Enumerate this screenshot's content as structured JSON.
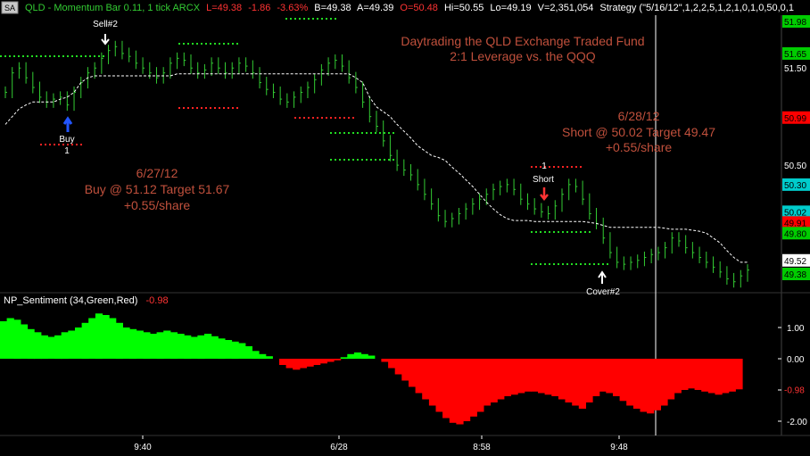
{
  "header": {
    "symbol_box": "SA",
    "title": "QLD - Momentum Bar 0.11, 1 tick  ARCX",
    "last": "L=49.38",
    "change": "-1.86",
    "change_pct": "-3.63%",
    "bid": "B=49.38",
    "ask": "A=49.39",
    "open": "O=50.48",
    "hi": "Hi=50.55",
    "lo": "Lo=49.19",
    "volume": "V=2,351,054",
    "strategy": "Strategy (\"5/16/12\",1,2,2,5,1,2,1,0,1,0,50,0,1"
  },
  "colors": {
    "up_bar": "#33cc33",
    "positive_area": "#00ff00",
    "negative_area": "#ff0000",
    "annotation": "#c0503c",
    "trailing_line": "#ffffff"
  },
  "annotations": {
    "main_title_1": "Daytrading the QLD Exchange Traded Fund",
    "main_title_2": "2:1 Leverage vs. the QQQ",
    "trade1_date": "6/27/12",
    "trade1_detail": "Buy @ 51.12 Target 51.67",
    "trade1_profit": "+0.55/share",
    "trade2_date": "6/28/12",
    "trade2_detail": "Short @ 50.02 Target 49.47",
    "trade2_profit": "+0.55/share"
  },
  "signals": {
    "sell2": "Sell#2",
    "buy": "Buy",
    "buy_num": "1",
    "short": "Short",
    "short_num": "1",
    "cover2": "Cover#2"
  },
  "indicator": {
    "name": "NP_Sentiment (34,Green,Red)",
    "value": "-0.98"
  },
  "chart_data": [
    {
      "type": "line",
      "panel": "price",
      "ylim": [
        49.2,
        52.1
      ],
      "price_axis_labels": [
        {
          "value": "51.98",
          "bg": "#00cc00",
          "fg": "#000000"
        },
        {
          "value": "51.65",
          "bg": "#00cc00",
          "fg": "#000000"
        },
        {
          "value": "51.50",
          "bg": "",
          "fg": "#ffffff"
        },
        {
          "value": "50.99",
          "bg": "#ff0000",
          "fg": "#000000"
        },
        {
          "value": "50.50",
          "bg": "",
          "fg": "#ffffff"
        },
        {
          "value": "50.30",
          "bg": "#00cccc",
          "fg": "#000000"
        },
        {
          "value": "50.02",
          "bg": "#00cccc",
          "fg": "#000000"
        },
        {
          "value": "49.91",
          "bg": "#ff0000",
          "fg": "#000000"
        },
        {
          "value": "49.80",
          "bg": "#00cc00",
          "fg": "#000000"
        },
        {
          "value": "49.52",
          "bg": "#ffffff",
          "fg": "#000000"
        },
        {
          "value": "49.38",
          "bg": "#00cc00",
          "fg": "#000000"
        }
      ],
      "series": [
        {
          "values": [
            51.25,
            51.45,
            51.5,
            51.4,
            51.3,
            51.2,
            51.15,
            51.18,
            51.2,
            51.12,
            51.25,
            51.35,
            51.45,
            51.5,
            51.6,
            51.68,
            51.72,
            51.65,
            51.62,
            51.55,
            51.5,
            51.45,
            51.4,
            51.45,
            51.55,
            51.6,
            51.58,
            51.5,
            51.45,
            51.48,
            51.55,
            51.5,
            51.45,
            51.5,
            51.55,
            51.52,
            51.45,
            51.35,
            51.28,
            51.25,
            51.18,
            51.15,
            51.2,
            51.25,
            51.3,
            51.38,
            51.48,
            51.55,
            51.58,
            51.52,
            51.4,
            51.3,
            51.15,
            51.0,
            50.9,
            50.75,
            50.6,
            50.5,
            50.45,
            50.4,
            50.3,
            50.2,
            50.1,
            49.98,
            49.92,
            49.95,
            50.0,
            50.05,
            50.1,
            50.15,
            50.2,
            50.25,
            50.28,
            50.3,
            50.25,
            50.15,
            50.1,
            50.05,
            50.02,
            50.0,
            50.08,
            50.2,
            50.3,
            50.28,
            50.15,
            50.0,
            49.9,
            49.75,
            49.6,
            49.5,
            49.48,
            49.5,
            49.52,
            49.55,
            49.58,
            49.6,
            49.65,
            49.75,
            49.72,
            49.65,
            49.6,
            49.55,
            49.5,
            49.45,
            49.4,
            49.33,
            49.3,
            49.36,
            49.42
          ]
        },
        {
          "values": [
            50.92,
            51.0,
            51.08,
            51.12,
            51.15,
            51.15,
            51.15,
            51.15,
            51.18,
            51.2,
            51.25,
            51.35,
            51.4,
            51.42,
            51.42,
            51.42,
            51.42,
            51.42,
            51.42,
            51.42,
            51.42,
            51.42,
            51.42,
            51.42,
            51.42,
            51.44,
            51.44,
            51.44,
            51.44,
            51.44,
            51.44,
            51.44,
            51.44,
            51.44,
            51.44,
            51.44,
            51.44,
            51.44,
            51.44,
            51.44,
            51.44,
            51.44,
            51.44,
            51.44,
            51.44,
            51.44,
            51.44,
            51.44,
            51.44,
            51.44,
            51.44,
            51.4,
            51.35,
            51.2,
            51.1,
            51.05,
            51.0,
            50.92,
            50.85,
            50.78,
            50.7,
            50.65,
            50.6,
            50.58,
            50.55,
            50.48,
            50.42,
            50.35,
            50.28,
            50.2,
            50.12,
            50.05,
            49.99,
            49.95,
            49.93,
            49.93,
            49.93,
            49.92,
            49.92,
            49.92,
            49.92,
            49.92,
            49.92,
            49.92,
            49.92,
            49.91,
            49.9,
            49.88,
            49.86,
            49.86,
            49.86,
            49.86,
            49.86,
            49.86,
            49.86,
            49.86,
            49.85,
            49.84,
            49.84,
            49.84,
            49.83,
            49.82,
            49.8,
            49.75,
            49.7,
            49.62,
            49.55,
            49.5,
            49.5
          ]
        }
      ]
    },
    {
      "type": "area",
      "panel": "indicator",
      "ylim": [
        -2.3,
        1.4
      ],
      "tick_labels": [
        "1.00",
        "0.00",
        "-1.00",
        "-2.00"
      ],
      "current_value_label": "-0.98",
      "values": [
        1.2,
        1.3,
        1.25,
        1.1,
        0.95,
        0.85,
        0.75,
        0.7,
        0.75,
        0.85,
        0.9,
        1.0,
        1.15,
        1.3,
        1.45,
        1.4,
        1.3,
        1.15,
        1.0,
        0.95,
        0.9,
        0.85,
        0.8,
        0.85,
        0.9,
        0.85,
        0.8,
        0.75,
        0.7,
        0.75,
        0.8,
        0.72,
        0.65,
        0.6,
        0.55,
        0.5,
        0.4,
        0.25,
        0.15,
        0.08,
        0.0,
        -0.2,
        -0.3,
        -0.35,
        -0.3,
        -0.25,
        -0.2,
        -0.15,
        -0.1,
        -0.05,
        0.05,
        0.15,
        0.2,
        0.15,
        0.1,
        0.0,
        -0.1,
        -0.3,
        -0.5,
        -0.7,
        -0.9,
        -1.1,
        -1.3,
        -1.5,
        -1.7,
        -1.9,
        -2.05,
        -2.1,
        -2.0,
        -1.85,
        -1.7,
        -1.5,
        -1.4,
        -1.3,
        -1.2,
        -1.15,
        -1.1,
        -1.05,
        -1.05,
        -1.1,
        -1.15,
        -1.2,
        -1.3,
        -1.4,
        -1.5,
        -1.6,
        -1.4,
        -1.2,
        -1.05,
        -1.1,
        -1.2,
        -1.35,
        -1.5,
        -1.6,
        -1.7,
        -1.75,
        -1.65,
        -1.5,
        -1.3,
        -1.1,
        -1.0,
        -0.95,
        -1.0,
        -1.05,
        -1.1,
        -1.15,
        -1.1,
        -1.05,
        -0.98
      ]
    }
  ],
  "time_axis": {
    "labels": [
      "9:40",
      "6/28",
      "8:58",
      "9:48"
    ]
  }
}
